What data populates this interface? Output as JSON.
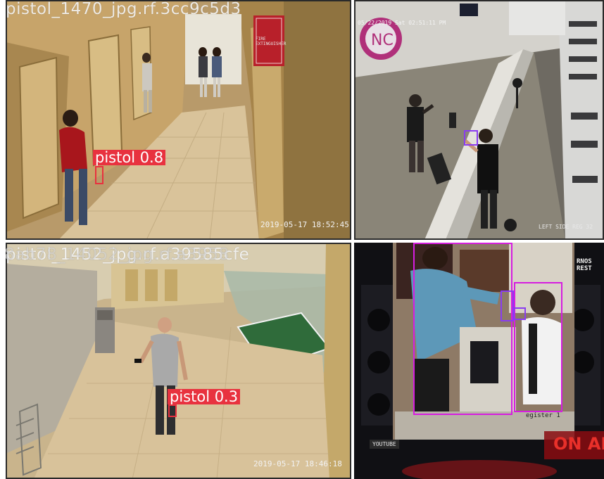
{
  "colors": {
    "detection_red": "#e8323f",
    "detection_magenta": "#d61de0",
    "detection_violet": "#8a3cf0"
  },
  "panels": {
    "top_left": {
      "file_label": "pistol_1470_jpg.rf.3cc9c5d3",
      "timestamp": "2019-05-17 18:52:45",
      "detection": {
        "label": "pistol 0.8"
      },
      "sign_text": "FIRE EXTINGUISHER"
    },
    "top_right": {
      "overlay_date": "05/22/2019 Sat 02:51:11 PM",
      "corner_text": "LEFT SIDE REG 32"
    },
    "bottom_left": {
      "file_label_a": "pistol_1452_jpg.rf.a39585cfe",
      "file_label_b": "8ab78_14052_jpg.rf.a3958",
      "timestamp": "2019-05-17 18:46:18",
      "detection": {
        "label": "pistol 0.3"
      }
    },
    "bottom_right": {
      "logo_text": "RNOS REST",
      "register_text": "egister 1",
      "channel_text": "YOUTUBE",
      "sign_text": "ON AI"
    }
  }
}
